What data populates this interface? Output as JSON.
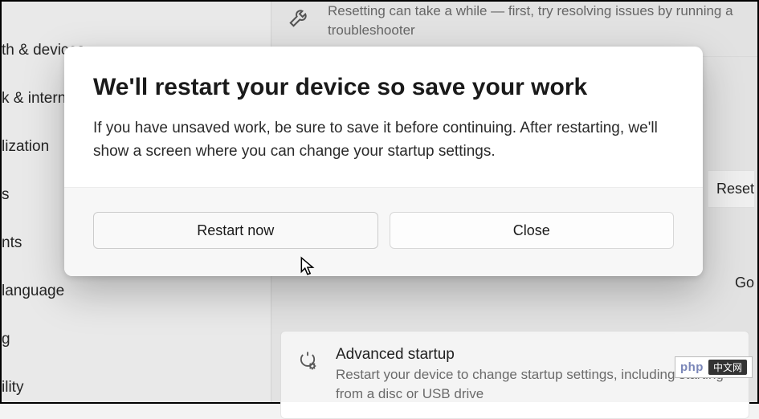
{
  "sidebar": {
    "items": [
      {
        "label": "th & devices"
      },
      {
        "label": "k & internet"
      },
      {
        "label": "lization"
      },
      {
        "label": "s"
      },
      {
        "label": "nts"
      },
      {
        "label": "language"
      },
      {
        "label": "g"
      },
      {
        "label": "ility"
      }
    ]
  },
  "background_top": {
    "desc": "Resetting can take a while — first, try resolving issues by running a troubleshooter"
  },
  "side_actions": {
    "reset": "Reset",
    "go": "Go"
  },
  "advanced": {
    "title": "Advanced startup",
    "desc": "Restart your device to change startup settings, including starting from a disc or USB drive"
  },
  "dialog": {
    "title": "We'll restart your device so save your work",
    "message": "If you have unsaved work, be sure to save it before continuing. After restarting, we'll show a screen where you can change your startup settings.",
    "restart_label": "Restart now",
    "close_label": "Close"
  },
  "watermark": {
    "brand": "php",
    "suffix": "中文网"
  }
}
